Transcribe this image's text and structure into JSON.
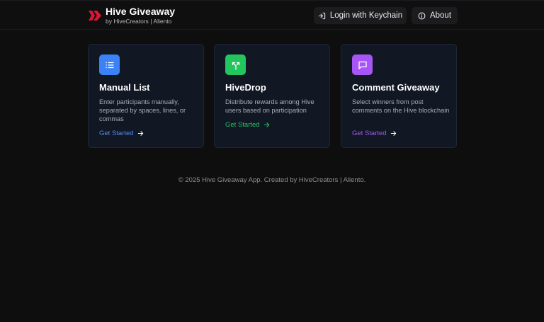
{
  "header": {
    "title": "Hive Giveaway",
    "subtitle": "by HiveCreators | Aliento",
    "login_label": "Login with Keychain",
    "about_label": "About",
    "logo_color": "#e31337"
  },
  "cards": [
    {
      "title": "Manual List",
      "description": "Enter participants manually, separated by spaces, lines, or commas",
      "cta": "Get Started",
      "icon": "list-icon",
      "accent": "#3b82f6"
    },
    {
      "title": "HiveDrop",
      "description": "Distribute rewards among Hive users based on participation",
      "cta": "Get Started",
      "icon": "split-arrows-icon",
      "accent": "#22c55e"
    },
    {
      "title": "Comment Giveaway",
      "description": "Select winners from post comments on the Hive blockchain",
      "cta": "Get Started",
      "icon": "message-icon",
      "accent": "#a855f7"
    }
  ],
  "footer": {
    "text": "© 2025 Hive Giveaway App. Created by HiveCreators | Aliento."
  }
}
